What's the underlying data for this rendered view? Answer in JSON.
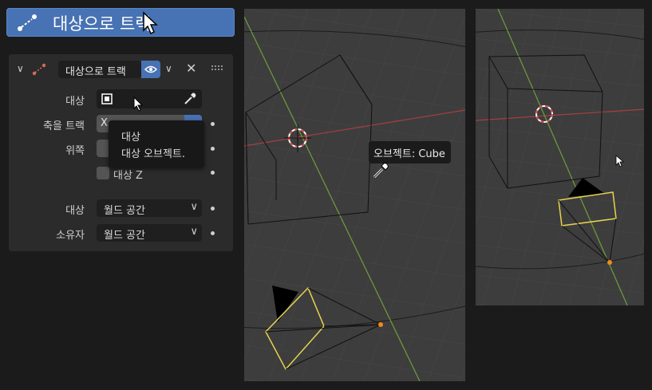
{
  "menu": {
    "label": "대상으로 트랙",
    "icon": "track-to-constraint-icon"
  },
  "constraint": {
    "name": "대상으로 트랙",
    "target_label": "대상",
    "track_axis_label": "축을 트랙",
    "track_axis_value": "X",
    "up_label": "위쪽",
    "target_z_label": "대상 Z",
    "target_space_label": "대상",
    "target_space_value": "월드 공간",
    "owner_space_label": "소유자",
    "owner_space_value": "월드 공간"
  },
  "tooltip": {
    "title": "대상",
    "description": "대상 오브젝트."
  },
  "viewport_tooltip": "오브젝트: Cube",
  "colors": {
    "accent": "#4772b3",
    "panel": "#2b2b2b",
    "viewport": "#3d3d3d",
    "axis_x": "#a83f3f",
    "axis_y": "#6f9d3c",
    "selection": "#e6d34d"
  }
}
